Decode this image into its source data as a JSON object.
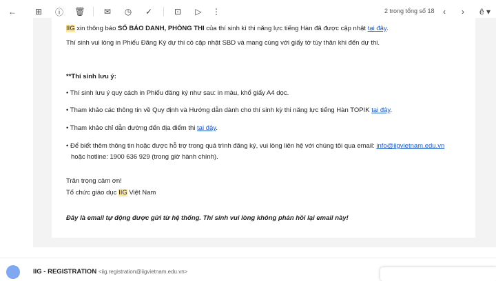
{
  "toolbar": {
    "back": "back-icon",
    "pagination": "2 trong tổng số 18"
  },
  "email": {
    "line1": {
      "hl": "IIG",
      "a": " xin thông báo ",
      "b": "SỐ BÁO DANH, PHÒNG THI",
      "c": " của thí sinh kì thi năng lực tiếng Hàn đã được cập nhật ",
      "link": "tại đây",
      "d": "."
    },
    "line2": "Thí sinh vui lòng in Phiếu Đăng Ký dự thi có cập nhật SBD và mang cùng với giấy tờ tùy thân khi đến dự thi.",
    "note_heading": "**Thí sinh lưu ý:",
    "bullets": [
      {
        "text": "Thí sinh lưu ý quy cách in Phiếu đăng ký như sau: in màu, khổ giấy A4 dọc."
      },
      {
        "text": "Tham khảo các thông tin về Quy định và Hướng dẫn dành cho thí sinh kỳ thi năng lực tiếng Hàn TOPIK ",
        "link": "tại đây",
        "end": "."
      },
      {
        "text": "Tham khảo chỉ dẫn đường đến địa điểm thi ",
        "link": "tại đây",
        "end": "."
      },
      {
        "text": "Để biết thêm thông tin hoặc được hỗ trợ trong quá trình đăng ký, vui lòng liên hệ với chúng tôi qua email: ",
        "link": "info@iigvietnam.edu.vn",
        "line2": "hoặc hotline: 1900 636 929 (trong giờ hành chính)."
      }
    ],
    "closing": "Trân trọng cảm ơn!",
    "org_a": "Tổ chức giáo dục ",
    "org_hl": "IIG",
    "org_b": " Việt Nam",
    "auto_note": "Đây là email tự động được gửi từ hệ thống. Thí sinh vui lòng không phản hồi lại email này!"
  },
  "next_email": {
    "sender": "IIG - REGISTRATION",
    "address": "<iig.registration@iigvietnam.edu.vn>"
  }
}
